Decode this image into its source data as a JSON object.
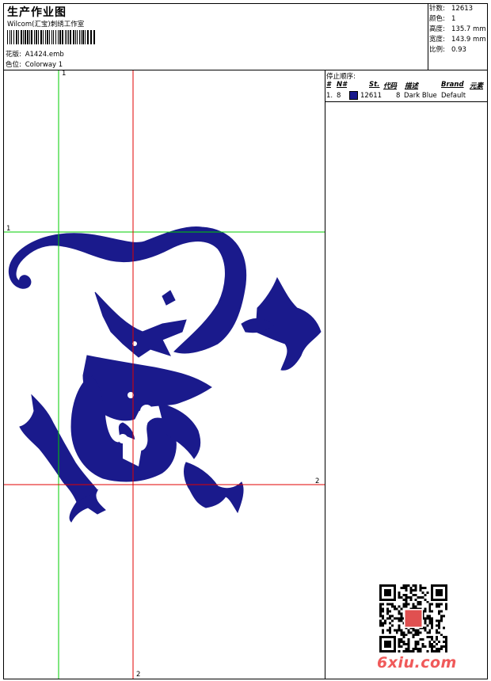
{
  "header": {
    "title": "生产作业图",
    "company": "Wilcom(汇宝)刺绣工作室",
    "design_label": "花版:",
    "design_value": "A1424.emb",
    "colorway_label": "色位:",
    "colorway_value": "Colorway 1"
  },
  "stats": [
    {
      "label": "针数:",
      "value": "12613"
    },
    {
      "label": "颜色:",
      "value": "1"
    },
    {
      "label": "高度:",
      "value": "135.7 mm"
    },
    {
      "label": "宽度:",
      "value": "143.9 mm"
    },
    {
      "label": "比例:",
      "value": "0.93"
    }
  ],
  "stop_sequence": {
    "title": "停止顺序:",
    "columns": [
      "#",
      "N#",
      "St.",
      "代码",
      "描述",
      "Brand",
      "元素"
    ],
    "rows": [
      {
        "index": "1.",
        "needle": "8",
        "stitches": "12611",
        "code": "8",
        "description": "Dark Blue",
        "brand": "Default",
        "color": "#1a1a8c"
      }
    ]
  },
  "guides": {
    "green_v_label": "1",
    "green_h_label": "1",
    "red_h_label": "2",
    "red_v_label": "2"
  },
  "design_color": "#1a1a8c",
  "watermark": "6xiu.com"
}
